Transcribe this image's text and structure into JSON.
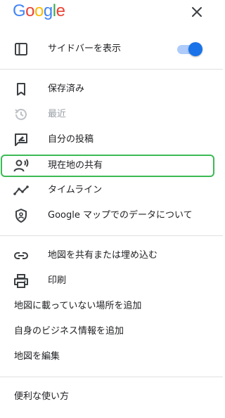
{
  "logo": {
    "text": "Google",
    "colors": [
      "#4285F4",
      "#EA4335",
      "#FBBC05",
      "#4285F4",
      "#34A853",
      "#EA4335"
    ]
  },
  "header": {
    "close_icon": "close-icon"
  },
  "menu": {
    "sidebar_toggle": {
      "label": "サイドバーを表示",
      "icon": "sidebar-icon",
      "enabled": true
    },
    "saved": {
      "label": "保存済み",
      "icon": "bookmark-icon"
    },
    "recent": {
      "label": "最近",
      "icon": "history-icon",
      "disabled": true
    },
    "contributions": {
      "label": "自分の投稿",
      "icon": "rate-review-icon"
    },
    "location_sharing": {
      "label": "現在地の共有",
      "icon": "location-sharing-icon",
      "highlighted": true
    },
    "timeline": {
      "label": "タイムライン",
      "icon": "timeline-icon"
    },
    "data_policy": {
      "label": "Google マップでのデータについて",
      "icon": "shield-icon"
    },
    "share_embed": {
      "label": "地図を共有または埋め込む",
      "icon": "link-icon"
    },
    "print": {
      "label": "印刷",
      "icon": "print-icon"
    },
    "add_missing_place": {
      "label": "地図に載っていない場所を追加"
    },
    "add_business": {
      "label": "自身のビジネス情報を追加"
    },
    "edit_map": {
      "label": "地図を編集"
    },
    "tips": {
      "label": "便利な使い方"
    }
  },
  "colors": {
    "accent": "#1a73e8",
    "highlight_border": "#3cba54",
    "disabled": "#9aa0a6",
    "icon": "#3c4043"
  }
}
